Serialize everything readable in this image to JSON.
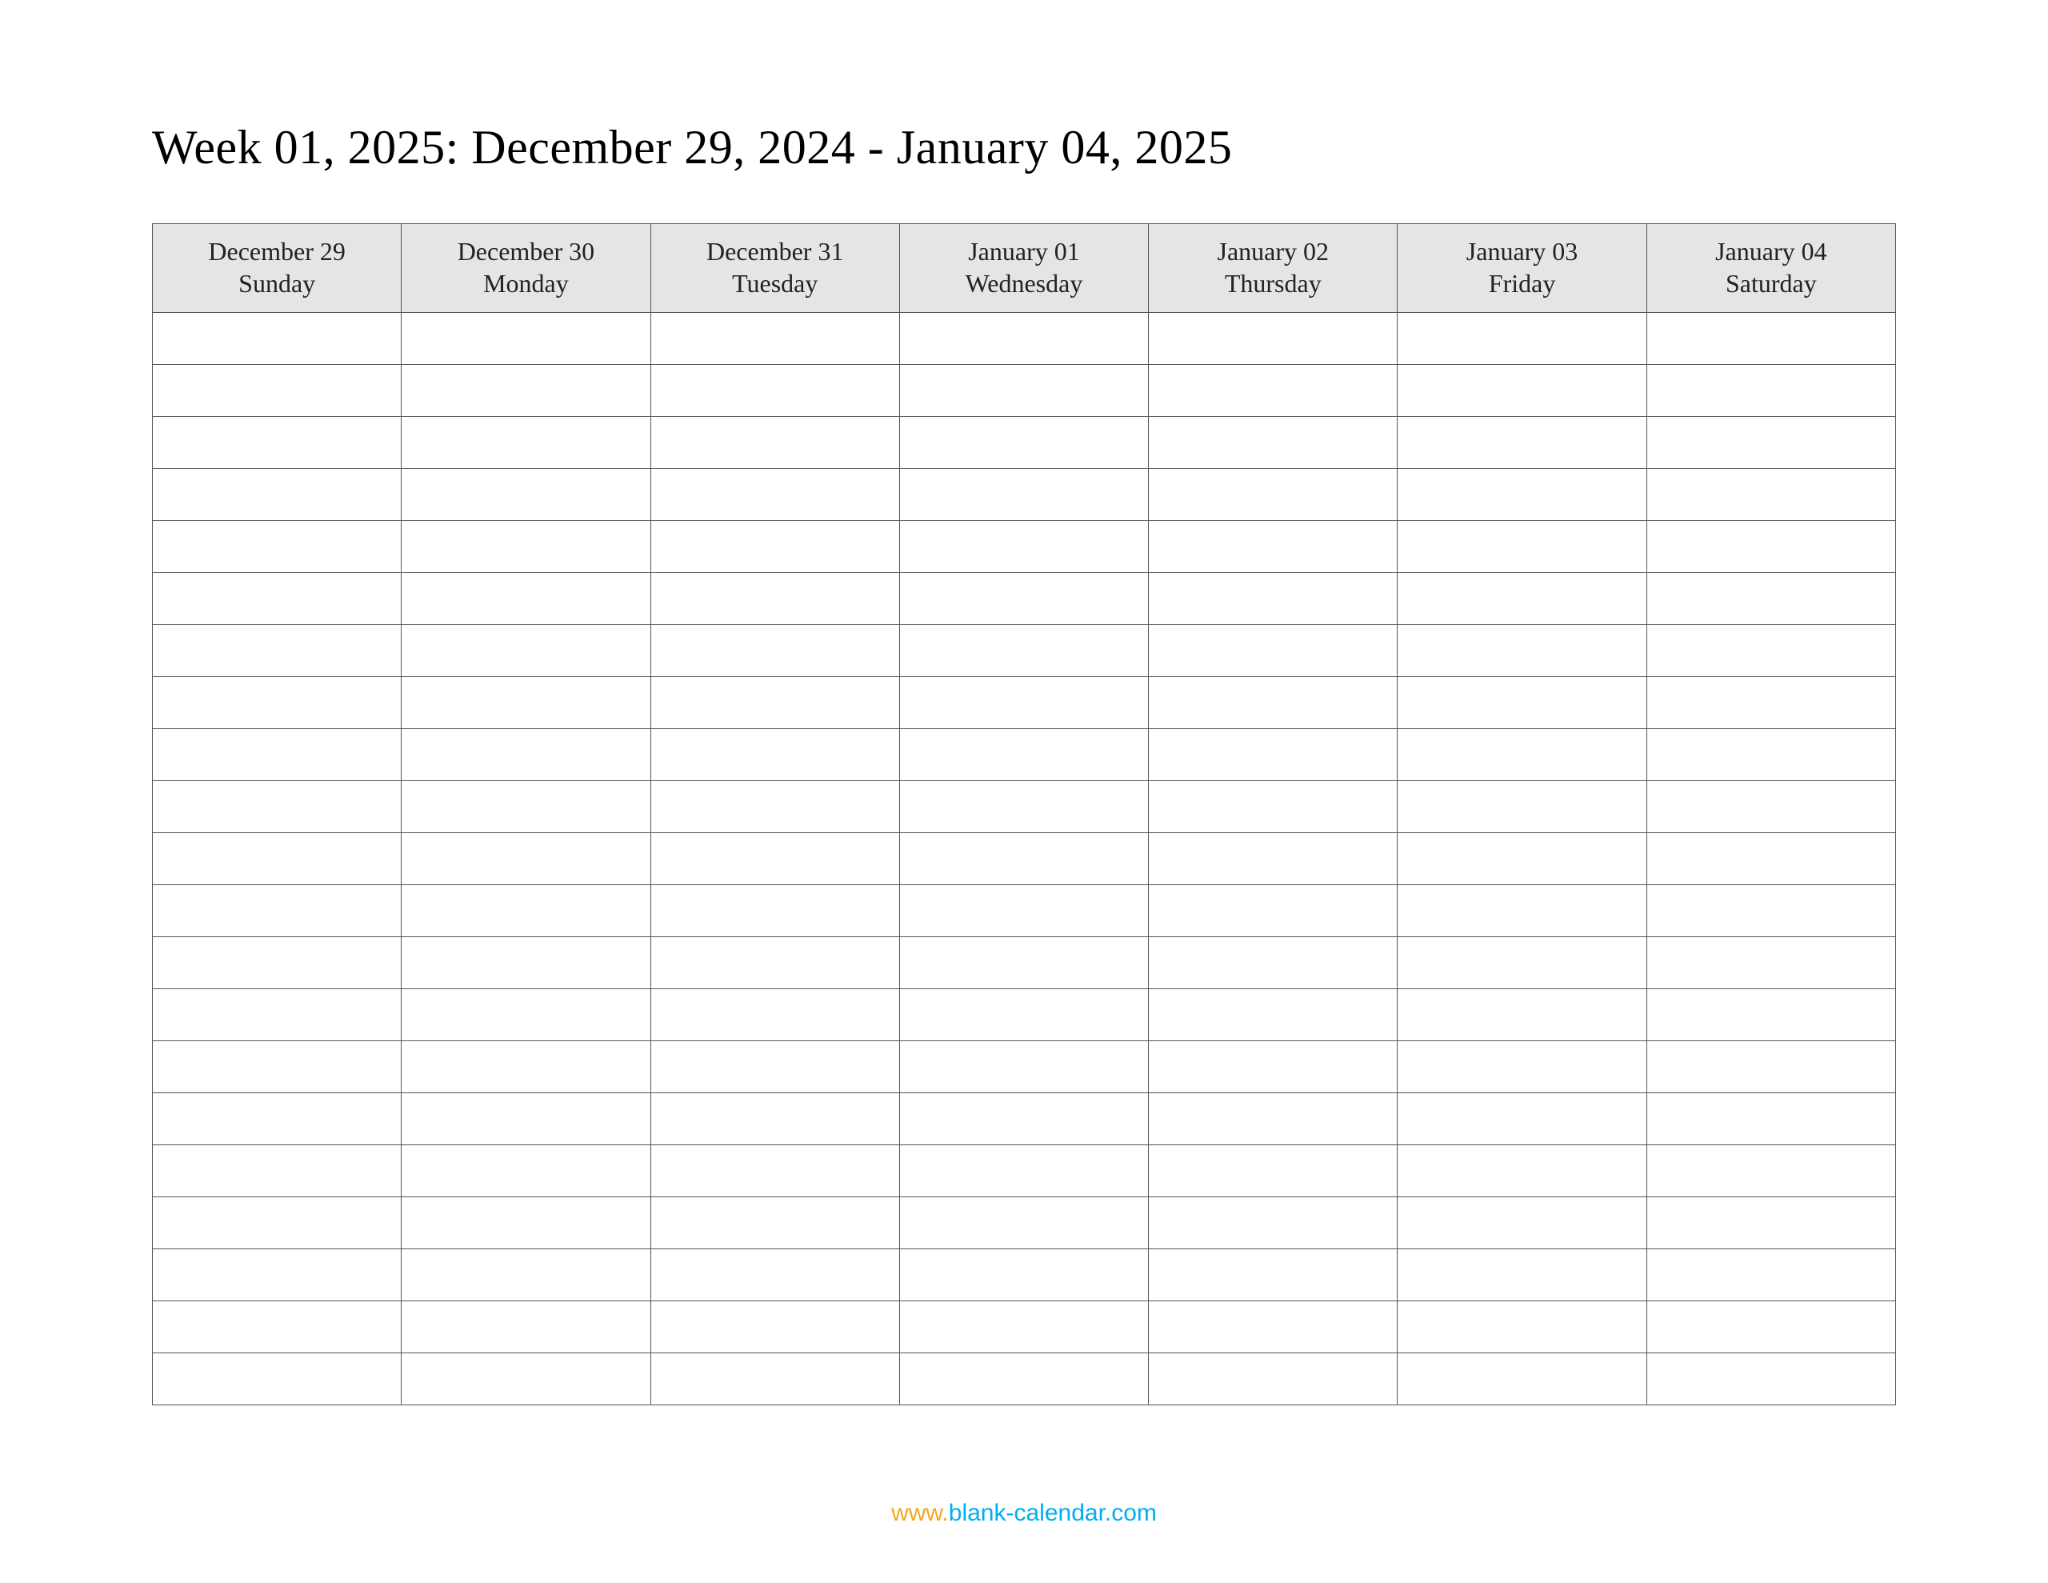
{
  "title": "Week 01, 2025: December 29, 2024 - January 04, 2025",
  "columns": [
    {
      "date": "December 29",
      "day": "Sunday"
    },
    {
      "date": "December 30",
      "day": "Monday"
    },
    {
      "date": "December 31",
      "day": "Tuesday"
    },
    {
      "date": "January 01",
      "day": "Wednesday"
    },
    {
      "date": "January 02",
      "day": "Thursday"
    },
    {
      "date": "January 03",
      "day": "Friday"
    },
    {
      "date": "January 04",
      "day": "Saturday"
    }
  ],
  "row_count": 21,
  "footer": {
    "prefix": "www.",
    "link_text": "blank-calendar.com"
  }
}
